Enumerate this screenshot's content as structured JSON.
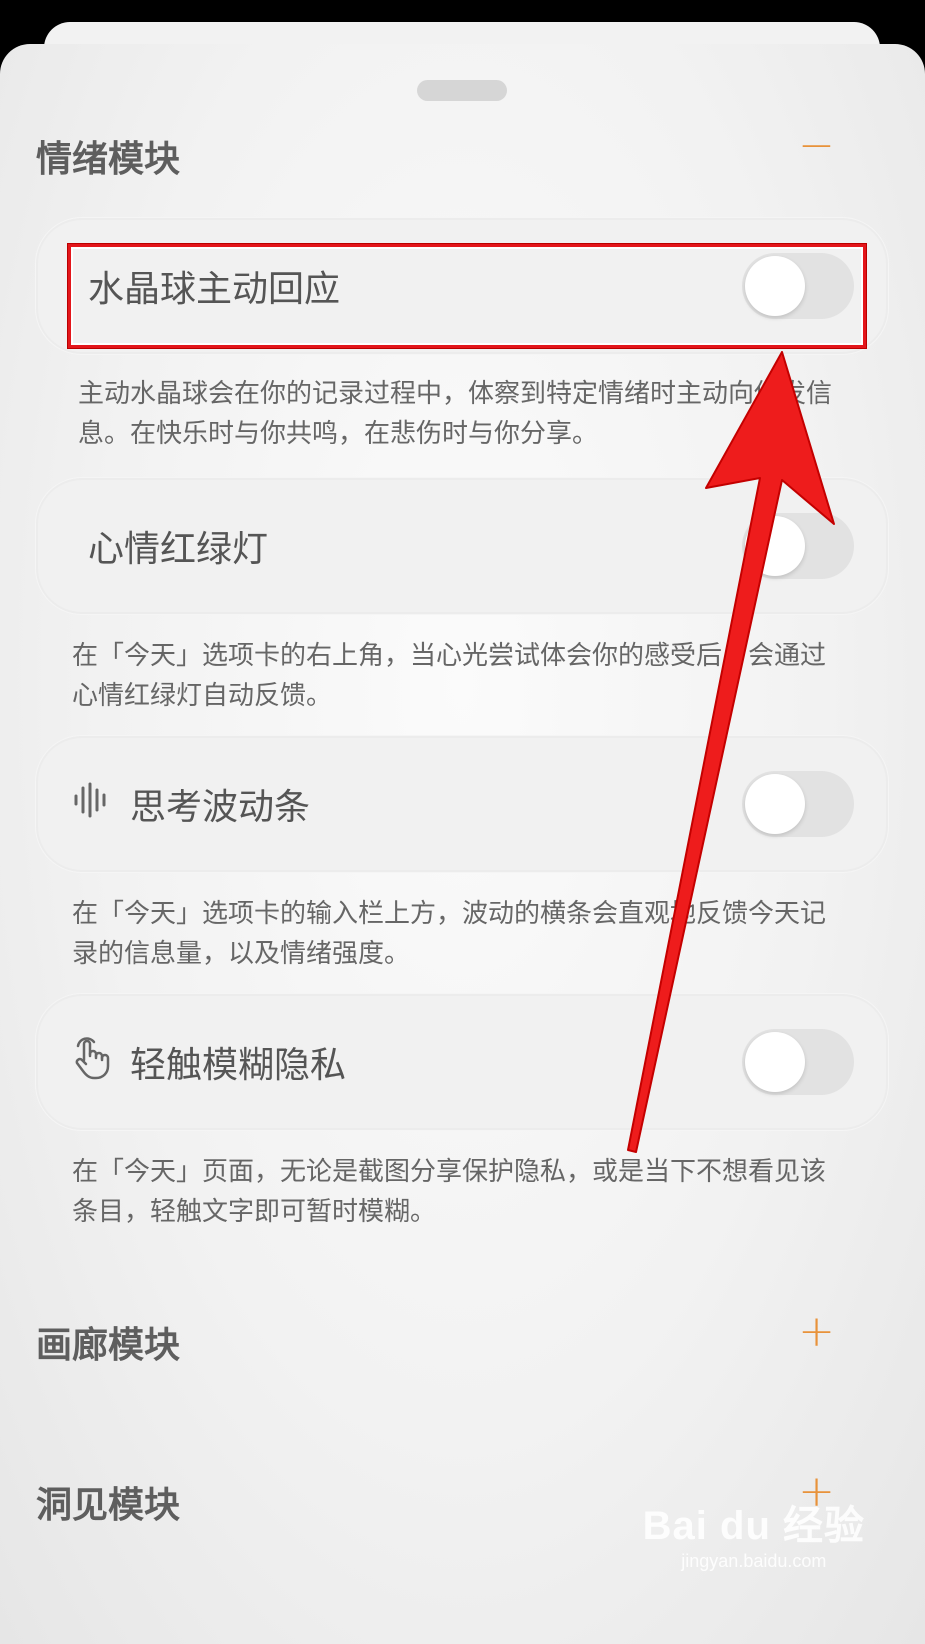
{
  "sections": {
    "mood": {
      "title": "情绪模块",
      "toggle_symbol": "−"
    },
    "gallery": {
      "title": "画廊模块",
      "toggle_symbol": "+"
    },
    "insight": {
      "title": "洞见模块",
      "toggle_symbol": "+"
    }
  },
  "settings": [
    {
      "label": "水晶球主动回应",
      "icon": "",
      "enabled": false,
      "description": "主动水晶球会在你的记录过程中，体察到特定情绪时主动向你发信息。在快乐时与你共鸣，在悲伤时与你分享。"
    },
    {
      "label": "心情红绿灯",
      "icon": "",
      "enabled": false,
      "description": "在「今天」选项卡的右上角，当心光尝试体会你的感受后，会通过心情红绿灯自动反馈。"
    },
    {
      "label": "思考波动条",
      "icon": "waveform-icon",
      "enabled": false,
      "description": "在「今天」选项卡的输入栏上方，波动的横条会直观地反馈今天记录的信息量，以及情绪强度。"
    },
    {
      "label": "轻触模糊隐私",
      "icon": "tap-hand-icon",
      "enabled": false,
      "description": "在「今天」页面，无论是截图分享保护隐私，或是当下不想看见该条目，轻触文字即可暂时模糊。"
    }
  ],
  "annotation": {
    "highlight_color": "#e3161b",
    "arrow_color": "#ee1c1c"
  },
  "watermark": {
    "brand": "Bai du 经验",
    "url": "jingyan.baidu.com"
  }
}
